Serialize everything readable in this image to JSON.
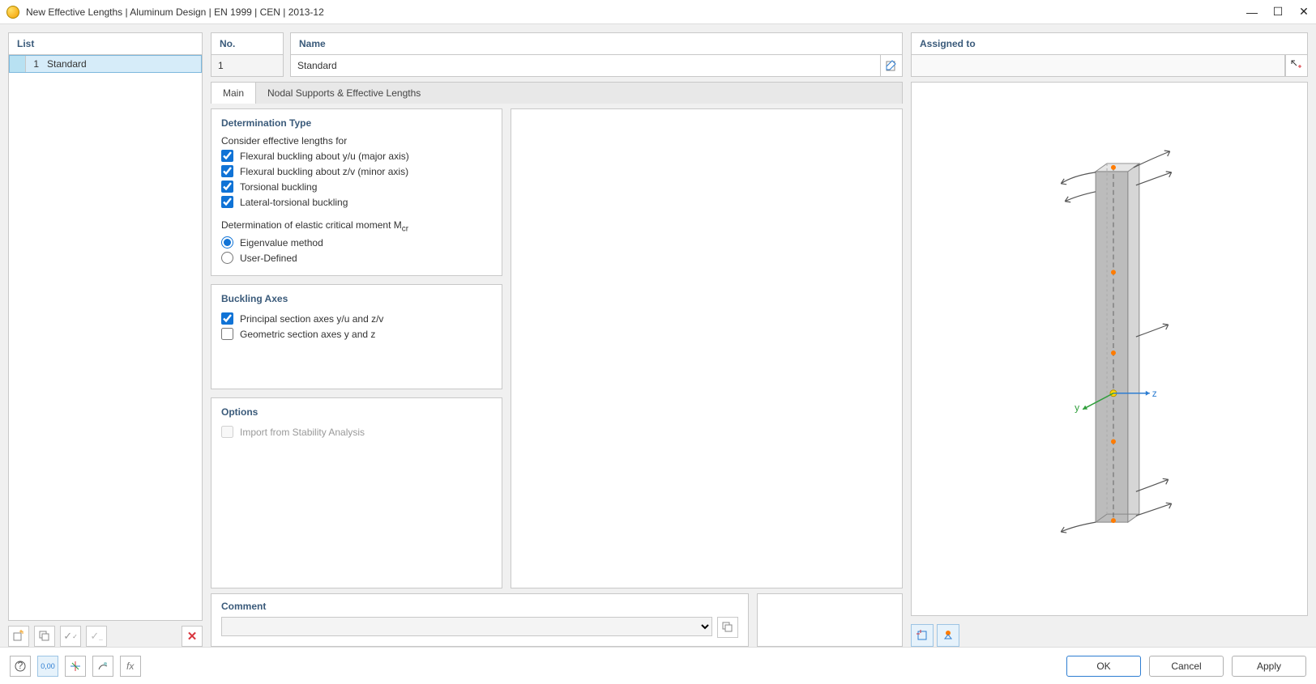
{
  "titlebar": {
    "title": "New Effective Lengths | Aluminum Design | EN 1999 | CEN | 2013-12"
  },
  "leftpanel": {
    "header": "List",
    "items": [
      {
        "num": "1",
        "name": "Standard"
      }
    ]
  },
  "header": {
    "no_label": "No.",
    "no_value": "1",
    "name_label": "Name",
    "name_value": "Standard",
    "assigned_label": "Assigned to",
    "assigned_value": ""
  },
  "tabs": {
    "main": "Main",
    "nodal": "Nodal Supports & Effective Lengths"
  },
  "determination": {
    "title": "Determination Type",
    "consider_label": "Consider effective lengths for",
    "chk1": "Flexural buckling about y/u (major axis)",
    "chk2": "Flexural buckling about z/v (minor axis)",
    "chk3": "Torsional buckling",
    "chk4": "Lateral-torsional buckling",
    "mcr_label_prefix": "Determination of elastic critical moment M",
    "mcr_label_sub": "cr",
    "rad1": "Eigenvalue method",
    "rad2": "User-Defined"
  },
  "axes": {
    "title": "Buckling Axes",
    "chk1": "Principal section axes y/u and z/v",
    "chk2": "Geometric section axes y and z"
  },
  "options": {
    "title": "Options",
    "chk1": "Import from Stability Analysis"
  },
  "comment": {
    "title": "Comment"
  },
  "preview": {
    "y_label": "y",
    "z_label": "z"
  },
  "buttons": {
    "ok": "OK",
    "cancel": "Cancel",
    "apply": "Apply"
  }
}
